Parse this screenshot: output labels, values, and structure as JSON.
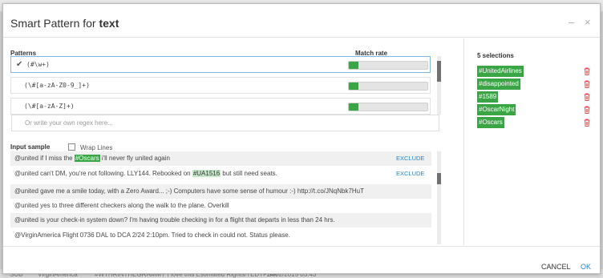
{
  "background": {
    "bottom_row_fragments": [
      "SUB",
      "VirginAmerica",
      "#WTHRINTHEGRAMMY I love this Estimated Rights/TEDTPSM",
      "14/02/2015 03:43"
    ]
  },
  "dialog": {
    "title_prefix": "Smart Pattern for",
    "title_field": "text",
    "minimize_icon": "–",
    "close_icon": "×"
  },
  "patterns": {
    "label": "Patterns",
    "match_rate_label": "Match rate",
    "items": [
      {
        "regex": "(#\\w+)",
        "selected": true,
        "match_rate": 0.12
      },
      {
        "regex": "(\\#[a-zA-Z0-9_]+)",
        "selected": false,
        "match_rate": 0.12
      },
      {
        "regex": "(\\#[a-zA-Z]+)",
        "selected": false,
        "match_rate": 0.12
      }
    ],
    "check_icon": "✔"
  },
  "regex_input": {
    "placeholder": "Or write your own regex here...",
    "value": ""
  },
  "input_sample": {
    "label": "Input sample",
    "wrap_lines_label": "Wrap Lines",
    "wrap_lines_checked": false,
    "exclude_label": "EXCLUDE",
    "rows": [
      {
        "before": "@united if I miss the ",
        "match": "#Oscars",
        "after": " i'll never fly united again",
        "match_style": "strong",
        "exclude": true
      },
      {
        "before": "@united can't DM, you're not following. LLY144. Rebooked on ",
        "match": "#UA1516",
        "after": " but still need seats.",
        "match_style": "light",
        "exclude": true
      },
      {
        "before": "@united gave me a smile today, with a Zero Award... ;-) Computers have some sense of humour :-) http://t.co/JNqNbk7HuT",
        "match": "",
        "after": "",
        "match_style": "",
        "exclude": false
      },
      {
        "before": "@united yes to three different checkers along the walk to the plane. Overkill",
        "match": "",
        "after": "",
        "match_style": "",
        "exclude": false
      },
      {
        "before": "@united is your check-in system down? I'm having trouble checking in for a flight that departs in less than 24 hrs.",
        "match": "",
        "after": "",
        "match_style": "",
        "exclude": false
      },
      {
        "before": "@VirginAmerica Flight 0736 DAL to DCA 2/24 2:10pm. Tried to check in could not. Status please.",
        "match": "",
        "after": "",
        "match_style": "",
        "exclude": false
      }
    ]
  },
  "selections": {
    "title": "5 selections",
    "items": [
      "#UnitedAirlines",
      "#disappointed",
      "#1589",
      "#OscarNight",
      "#Oscars"
    ]
  },
  "footer": {
    "cancel_label": "CANCEL",
    "ok_label": "OK"
  },
  "colors": {
    "accent_green": "#3aa545",
    "link_blue": "#2a84c8",
    "delete_red": "#d9534f"
  }
}
